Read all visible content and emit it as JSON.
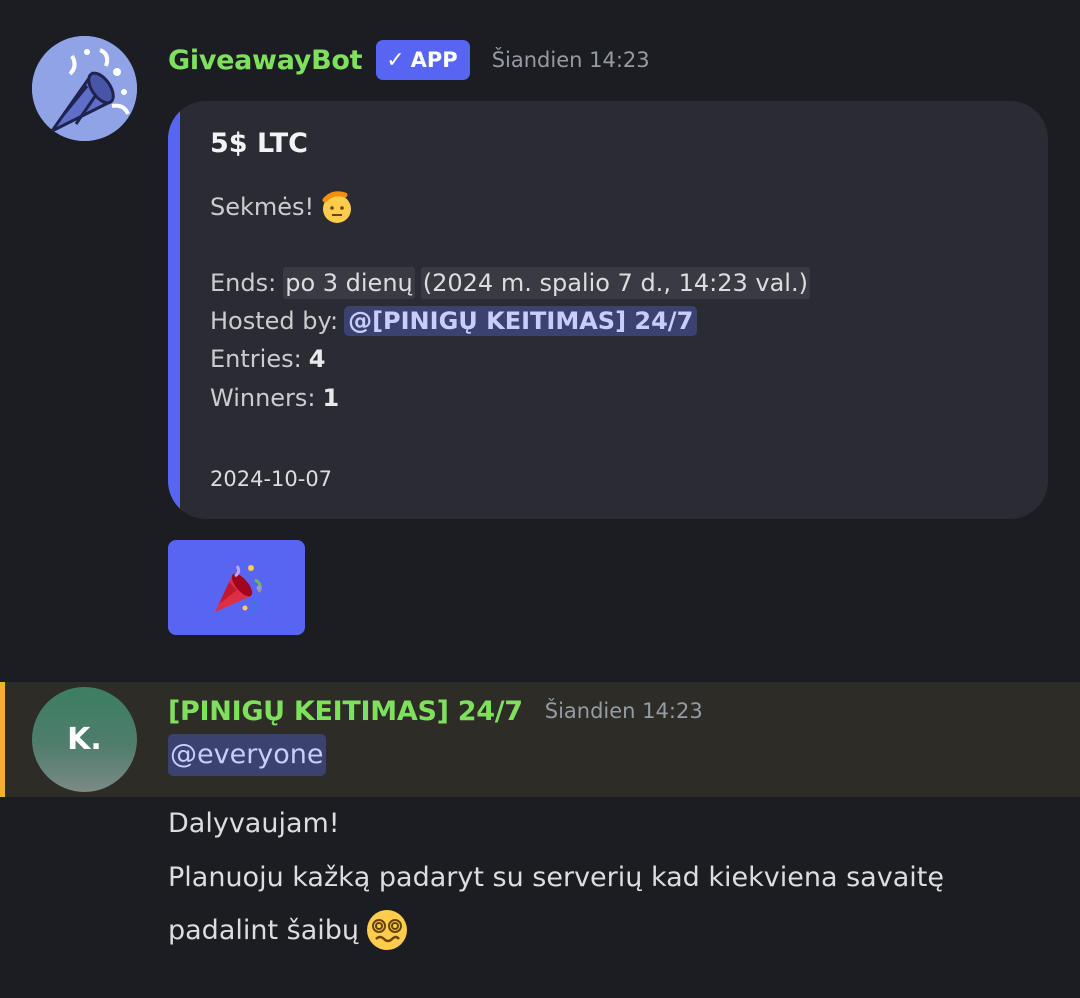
{
  "message1": {
    "author": "GiveawayBot",
    "badge": "APP",
    "badge_icon": "check-icon",
    "timestamp": "Šiandien 14:23",
    "embed": {
      "accent_color": "#5865f2",
      "title": "5$ LTC",
      "description": "Sekmės!",
      "description_emoji": "saluting-face-emoji",
      "ends_label": "Ends:",
      "ends_relative": "po 3 dienų",
      "ends_absolute": "(2024 m. spalio 7 d., 14:23 val.)",
      "hosted_label": "Hosted by:",
      "hosted_by": "@[PINIGŲ KEITIMAS]  24/7",
      "entries_label": "Entries:",
      "entries": "4",
      "winners_label": "Winners:",
      "winners": "1",
      "footer_date": "2024-10-07"
    },
    "button": {
      "icon": "party-popper-icon",
      "color": "#5865f2"
    }
  },
  "message2": {
    "avatar_text": "K.",
    "author": "[PINIGŲ KEITIMAS]  24/7",
    "timestamp": "Šiandien 14:23",
    "mention": "@everyone",
    "highlight_color": "#f0b232"
  },
  "message3": {
    "line1": "Dalyvaujam!",
    "line2": "Planuoju kažką padaryt su serverių kad kiekviena savaitę",
    "line3": "padalint šaibų",
    "line3_emoji": "woozy-face-emoji"
  }
}
